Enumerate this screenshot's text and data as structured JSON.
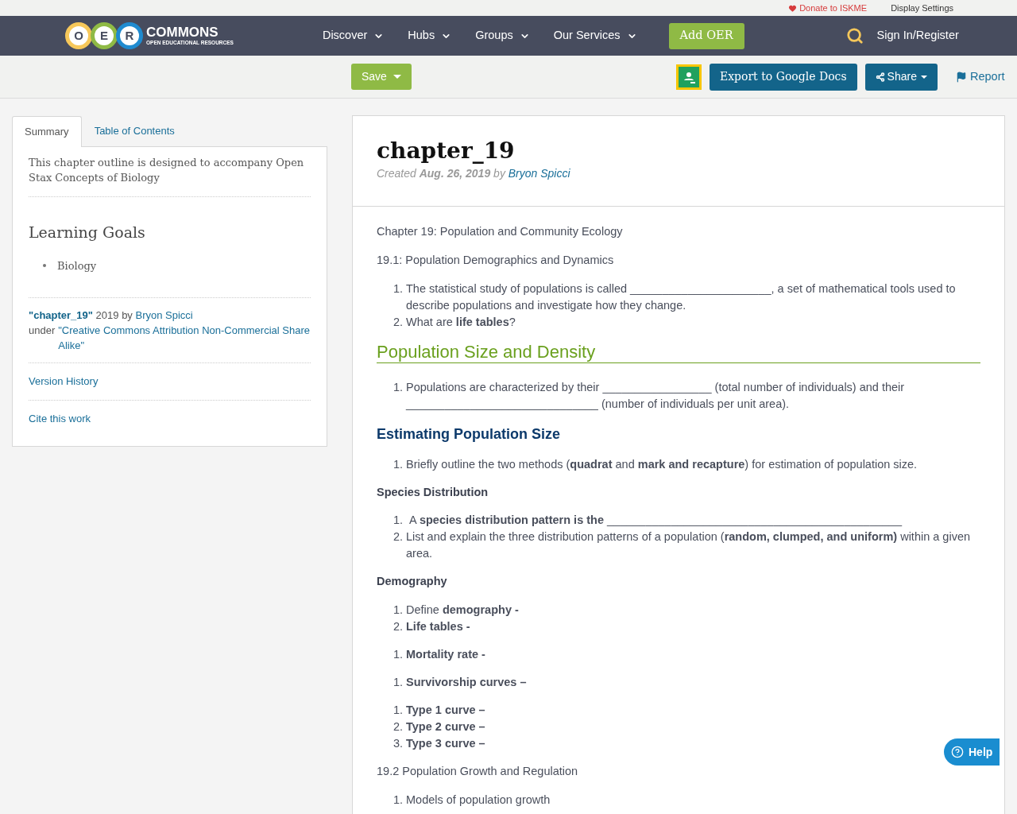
{
  "top_bar": {
    "donate": "Donate to ISKME",
    "display_settings": "Display Settings"
  },
  "nav": {
    "logo": {
      "letters": [
        "O",
        "E",
        "R"
      ],
      "name": "COMMONS",
      "tagline": "OPEN EDUCATIONAL RESOURCES"
    },
    "menu": [
      "Discover",
      "Hubs",
      "Groups",
      "Our Services"
    ],
    "add_oer": "Add OER",
    "sign_in": "Sign In/Register"
  },
  "toolbar": {
    "save": "Save",
    "export": "Export to Google Docs",
    "share": "Share",
    "report": "Report"
  },
  "sidebar": {
    "tabs": [
      {
        "label": "Summary",
        "selected": true
      },
      {
        "label": "Table of Contents",
        "selected": false
      }
    ],
    "description": "This chapter outline is designed to accompany Open Stax Concepts of Biology",
    "goals_title": "Learning Goals",
    "goals": [
      "Biology"
    ],
    "attribution": {
      "title_link": "\"chapter_19\"",
      "year_by": "2019 by",
      "author_link": "Bryon Spicci",
      "under": "under",
      "license_link": "\"Creative Commons Attribution Non-Commercial Share Alike\""
    },
    "links": [
      "Version History",
      "Cite this work"
    ]
  },
  "main": {
    "title": "chapter_19",
    "meta": {
      "created": "Created",
      "date": "Aug. 26, 2019",
      "by": "by",
      "author": "Bryon Spicci"
    },
    "blocks": [
      {
        "kind": "para",
        "text": "Chapter 19: Population and Community Ecology"
      },
      {
        "kind": "para",
        "text": "19.1: Population Demographics and Dynamics"
      },
      {
        "kind": "list",
        "items": [
          {
            "marker": "1.",
            "text": "The statistical study of populations is called ______________________, a set of mathematical tools used to describe populations and investigate how they change."
          },
          {
            "marker": "2.",
            "text": "What are **life tables**?"
          }
        ]
      },
      {
        "kind": "section",
        "text": "Population Size and Density"
      },
      {
        "kind": "list",
        "items": [
          {
            "marker": "1.",
            "text": "Populations are characterized by their _________________ (total number of individuals) and their ______________________________ (number of individuals per unit area)."
          }
        ]
      },
      {
        "kind": "subsection",
        "text": "Estimating Population Size"
      },
      {
        "kind": "list",
        "items": [
          {
            "marker": "1.",
            "text": "Briefly outline the two methods (**quadrat** and **mark and recapture**) for estimation of population size."
          }
        ]
      },
      {
        "kind": "label",
        "text": "Species Distribution"
      },
      {
        "kind": "list",
        "items": [
          {
            "marker": "1.",
            "text": " A **species distribution pattern is the** ______________________________________________"
          },
          {
            "marker": "2.",
            "text": "List and explain the three distribution patterns of a population (**random, clumped, and uniform)** within a given area."
          }
        ]
      },
      {
        "kind": "label",
        "text": "Demography"
      },
      {
        "kind": "list",
        "items": [
          {
            "marker": "1.",
            "text": "Define **demography -**"
          },
          {
            "marker": "2.",
            "text": "**Life tables -**"
          }
        ]
      },
      {
        "kind": "list",
        "items": [
          {
            "marker": "1.",
            "text": "**Mortality rate -**"
          }
        ]
      },
      {
        "kind": "list",
        "items": [
          {
            "marker": "1.",
            "text": "**Survivorship curves –**"
          }
        ]
      },
      {
        "kind": "list",
        "items": [
          {
            "marker": "1.",
            "text": "**Type 1 curve –**"
          },
          {
            "marker": "2.",
            "text": "**Type 2 curve –**"
          },
          {
            "marker": "3.",
            "text": "**Type 3 curve –**"
          }
        ]
      },
      {
        "kind": "para",
        "text": "19.2 Population Growth and Regulation"
      },
      {
        "kind": "list",
        "items": [
          {
            "marker": "1.",
            "text": "Models of population growth"
          }
        ]
      }
    ]
  },
  "help": "Help"
}
